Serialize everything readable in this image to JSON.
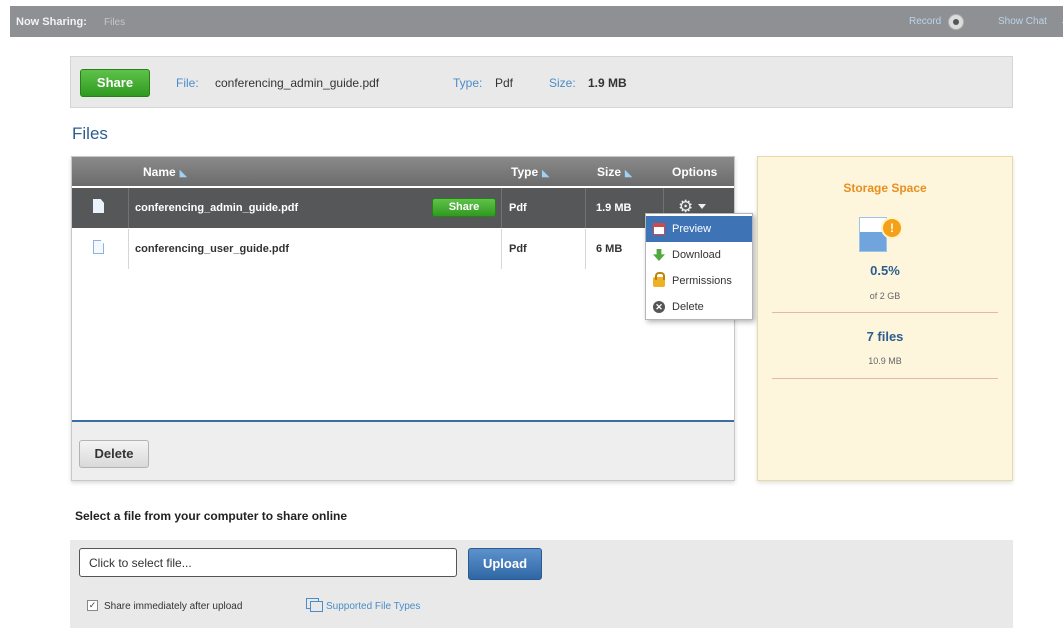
{
  "topbar": {
    "now_sharing_label": "Now Sharing:",
    "now_sharing_value": "Files",
    "record_label": "Record",
    "show_chat_label": "Show Chat"
  },
  "sharebar": {
    "share_label": "Share",
    "file_label": "File:",
    "file_value": "conferencing_admin_guide.pdf",
    "type_label": "Type:",
    "type_value": "Pdf",
    "size_label": "Size:",
    "size_value": "1.9 MB"
  },
  "files": {
    "heading": "Files",
    "columns": {
      "name": "Name",
      "type": "Type",
      "size": "Size",
      "options": "Options"
    },
    "rows": [
      {
        "name": "conferencing_admin_guide.pdf",
        "type": "Pdf",
        "size": "1.9 MB",
        "share_label": "Share",
        "selected": true
      },
      {
        "name": "conferencing_user_guide.pdf",
        "type": "Pdf",
        "size": "6 MB",
        "selected": false
      }
    ],
    "delete_label": "Delete"
  },
  "options_menu": {
    "items": [
      {
        "label": "Preview",
        "icon": "preview-icon",
        "active": true
      },
      {
        "label": "Download",
        "icon": "download-icon",
        "active": false
      },
      {
        "label": "Permissions",
        "icon": "lock-icon",
        "active": false
      },
      {
        "label": "Delete",
        "icon": "delete-icon",
        "active": false
      }
    ]
  },
  "storage": {
    "title": "Storage Space",
    "percent": "0.5%",
    "quota": "of 2 GB",
    "files_count": "7 files",
    "files_size": "10.9 MB",
    "used_fraction": 0.005
  },
  "upload": {
    "heading": "Select a file from your computer to share online",
    "input_value": "Click to select file...",
    "upload_label": "Upload",
    "share_immediately_label": "Share immediately after upload",
    "share_immediately_checked": true,
    "supported_types_label": "Supported File Types"
  },
  "colors": {
    "accent_blue": "#2c5d8f",
    "share_green": "#2f9a1f",
    "storage_title_orange": "#e78f1e",
    "menu_highlight": "#3e73b6"
  }
}
